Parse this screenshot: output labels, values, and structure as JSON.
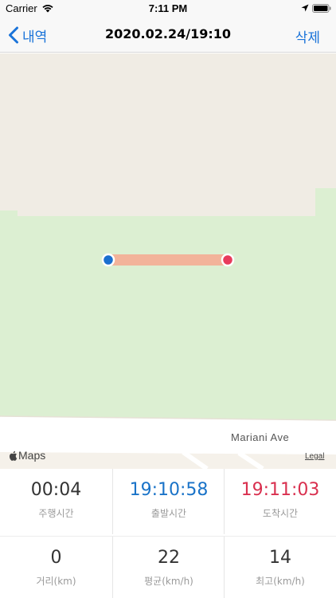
{
  "status_bar": {
    "carrier": "Carrier",
    "time": "7:11 PM",
    "icons": [
      "wifi-icon",
      "location-arrow-icon",
      "battery-icon"
    ]
  },
  "nav": {
    "back_label": "내역",
    "title": "2020.02.24/19:10",
    "delete_label": "삭제",
    "back_icon": "chevron-left-icon"
  },
  "map": {
    "street_label": "Mariani Ave",
    "attribution": "Maps",
    "legal": "Legal",
    "colors": {
      "land": "#f0ece4",
      "park": "#dcefd2",
      "road": "#ffffff",
      "route": "#f2b39a",
      "start_marker": "#1a6fcf",
      "end_marker": "#e83b5c"
    }
  },
  "stats": {
    "row1": [
      {
        "value": "00:04",
        "label": "주행시간"
      },
      {
        "value": "19:10:58",
        "label": "출발시간"
      },
      {
        "value": "19:11:03",
        "label": "도착시간"
      }
    ],
    "row2": [
      {
        "value": "0",
        "label": "거리(km)"
      },
      {
        "value": "22",
        "label": "평균(km/h)"
      },
      {
        "value": "14",
        "label": "최고(km/h)"
      }
    ],
    "colors": {
      "start": "#1a73c8",
      "end": "#d9304f"
    }
  }
}
